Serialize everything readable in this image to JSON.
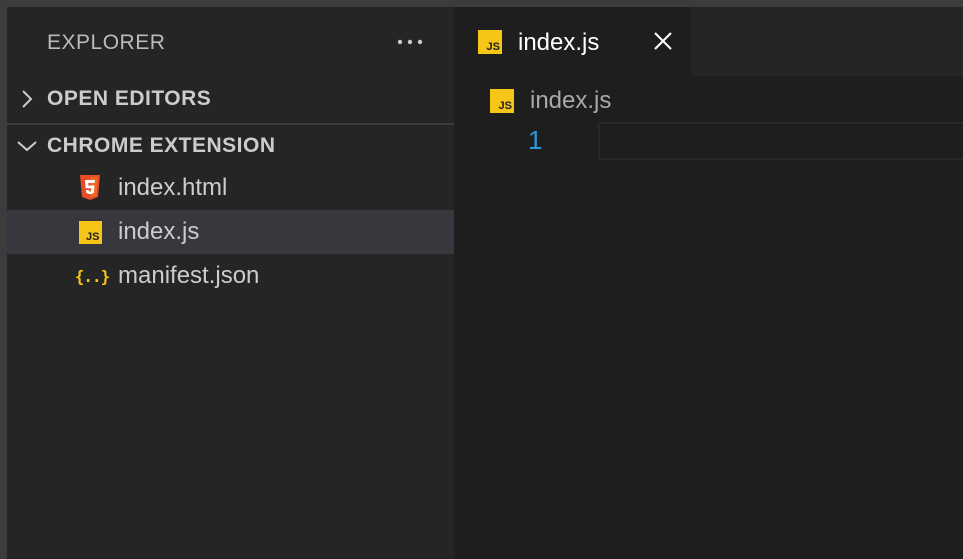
{
  "sidebar": {
    "title": "EXPLORER",
    "more_icon": "ellipsis-icon",
    "sections": [
      {
        "label": "OPEN EDITORS",
        "expanded": false
      },
      {
        "label": "CHROME EXTENSION",
        "expanded": true
      }
    ],
    "files": [
      {
        "name": "index.html",
        "icon": "html5-icon",
        "selected": false
      },
      {
        "name": "index.js",
        "icon": "javascript-icon",
        "selected": true
      },
      {
        "name": "manifest.json",
        "icon": "json-icon",
        "selected": false
      }
    ]
  },
  "editor": {
    "tab": {
      "label": "index.js",
      "icon": "javascript-icon",
      "close_icon": "close-icon"
    },
    "breadcrumb": {
      "label": "index.js",
      "icon": "javascript-icon"
    },
    "line_numbers": [
      "1"
    ]
  },
  "icons": {
    "js_badge_text": "JS",
    "json_glyph": "{..}"
  },
  "colors": {
    "sidebar_bg": "#252526",
    "editor_bg": "#1e1e1e",
    "selected_row": "#37373d",
    "js_yellow": "#f5c518",
    "html_orange": "#e44d26",
    "json_yellow": "#f5c518",
    "line_number": "#2b9bd8"
  }
}
